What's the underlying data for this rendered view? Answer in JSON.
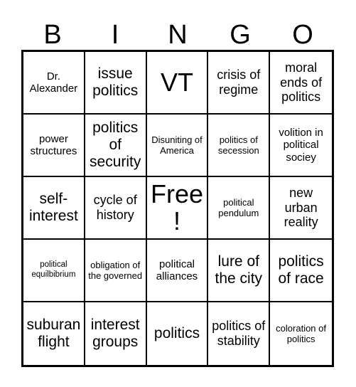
{
  "card": {
    "title": "BINGO",
    "header_letters": [
      "B",
      "I",
      "N",
      "G",
      "O"
    ],
    "free_space_label": "Free!",
    "grid_size": "5x5",
    "colors": {
      "background": "#ffffff",
      "text": "#000000",
      "border": "#000000"
    },
    "rows": [
      [
        {
          "text": "Dr. Alexander",
          "size": "sm"
        },
        {
          "text": "issue politics",
          "size": "lg"
        },
        {
          "text": "VT",
          "size": "xl"
        },
        {
          "text": "crisis of regime",
          "size": "md"
        },
        {
          "text": "moral ends of politics",
          "size": "md"
        }
      ],
      [
        {
          "text": "power structures",
          "size": "sm"
        },
        {
          "text": "politics of security",
          "size": "lg"
        },
        {
          "text": "Disuniting of America",
          "size": "xs"
        },
        {
          "text": "politics of secession",
          "size": "xs"
        },
        {
          "text": "volition in political sociey",
          "size": "sm"
        }
      ],
      [
        {
          "text": "self-interest",
          "size": "lg"
        },
        {
          "text": "cycle of history",
          "size": "md"
        },
        {
          "text": "Free!",
          "size": "xl"
        },
        {
          "text": "political pendulum",
          "size": "xs"
        },
        {
          "text": "new urban reality",
          "size": "md"
        }
      ],
      [
        {
          "text": "political equilbibrium",
          "size": "xxs"
        },
        {
          "text": "obligation of the governed",
          "size": "xs"
        },
        {
          "text": "political alliances",
          "size": "sm"
        },
        {
          "text": "lure of the city",
          "size": "lg"
        },
        {
          "text": "politics of race",
          "size": "lg"
        }
      ],
      [
        {
          "text": "suburan flight",
          "size": "lg"
        },
        {
          "text": "interest groups",
          "size": "lg"
        },
        {
          "text": "politics",
          "size": "lg"
        },
        {
          "text": "politics of stability",
          "size": "md"
        },
        {
          "text": "coloration of politics",
          "size": "xs"
        }
      ]
    ]
  }
}
